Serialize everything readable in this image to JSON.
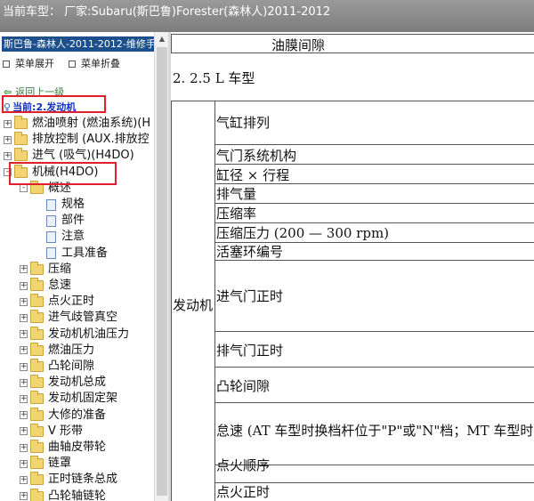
{
  "header": {
    "title": "当前车型： 厂家:Subaru(斯巴鲁)Forester(森林人)2011-2012"
  },
  "sidebar": {
    "title": "斯巴鲁-森林人-2011-2012-维修手",
    "expand_menu": "菜单展开",
    "collapse_menu": "菜单折叠",
    "back_label": "返回上一级",
    "current_label": "当前:2.发动机",
    "tree": [
      {
        "label": "燃油喷射 (燃油系统)(H",
        "type": "folder",
        "toggle": "+"
      },
      {
        "label": "排放控制 (AUX.排放控",
        "type": "folder",
        "toggle": "+"
      },
      {
        "label": "进气 (吸气)(H4DO)",
        "type": "folder",
        "toggle": "+"
      },
      {
        "label": "机械(H4DO)",
        "type": "folder",
        "toggle": "-"
      },
      {
        "label": "概述",
        "type": "folder",
        "toggle": "-"
      },
      {
        "label": "规格",
        "type": "doc"
      },
      {
        "label": "部件",
        "type": "doc"
      },
      {
        "label": "注意",
        "type": "doc"
      },
      {
        "label": "工具准备",
        "type": "doc"
      },
      {
        "label": "压缩",
        "type": "folder",
        "toggle": "+"
      },
      {
        "label": "怠速",
        "type": "folder",
        "toggle": "+"
      },
      {
        "label": "点火正时",
        "type": "folder",
        "toggle": "+"
      },
      {
        "label": "进气歧管真空",
        "type": "folder",
        "toggle": "+"
      },
      {
        "label": "发动机机油压力",
        "type": "folder",
        "toggle": "+"
      },
      {
        "label": "燃油压力",
        "type": "folder",
        "toggle": "+"
      },
      {
        "label": "凸轮间隙",
        "type": "folder",
        "toggle": "+"
      },
      {
        "label": "发动机总成",
        "type": "folder",
        "toggle": "+"
      },
      {
        "label": "发动机固定架",
        "type": "folder",
        "toggle": "+"
      },
      {
        "label": "大修的准备",
        "type": "folder",
        "toggle": "+"
      },
      {
        "label": "V 形带",
        "type": "folder",
        "toggle": "+"
      },
      {
        "label": "曲轴皮带轮",
        "type": "folder",
        "toggle": "+"
      },
      {
        "label": "链罩",
        "type": "folder",
        "toggle": "+"
      },
      {
        "label": "正时链条总成",
        "type": "folder",
        "toggle": "+"
      },
      {
        "label": "凸轮轴链轮",
        "type": "folder",
        "toggle": "+"
      }
    ]
  },
  "content": {
    "top_cell": "油膜间隙",
    "section_title": "2. 2.5 L 车型",
    "group_label": "发动机",
    "rows": [
      "气缸排列",
      "气门系统机构",
      "缸径 × 行程",
      "排气量",
      "压缩率",
      "压缩压力 (200 — 300 rpm)",
      "活塞环编号",
      "进气门正时",
      "排气门正时",
      "凸轮间隙",
      "怠速 (AT 车型时换档杆位于\"P\"或\"N\"档；MT 车型时",
      "点火顺序",
      "点火正时"
    ]
  }
}
